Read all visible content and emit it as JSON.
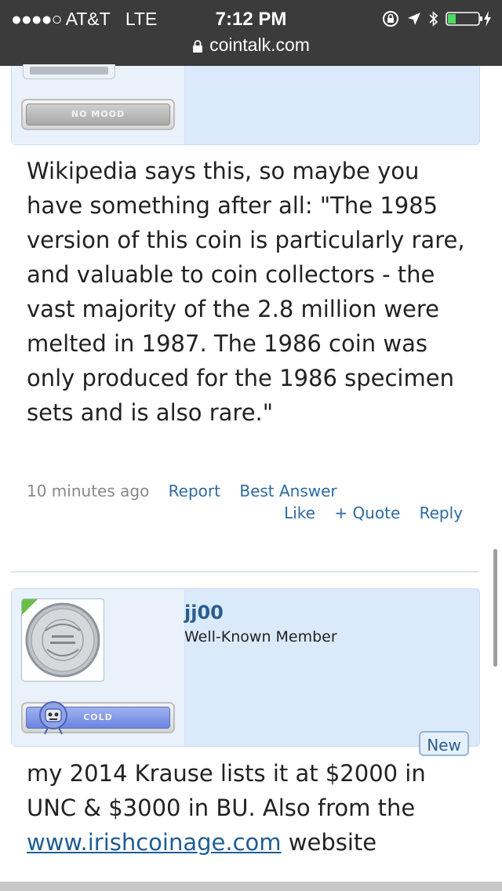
{
  "status_bar": {
    "signal_dots": "●●●●○",
    "carrier": "AT&T",
    "network": "LTE",
    "time": "7:12 PM",
    "url": "cointalk.com",
    "icons": [
      "rotation-lock-icon",
      "location-arrow-icon",
      "bluetooth-icon",
      "battery-charging-icon"
    ]
  },
  "post1": {
    "mood_label": "NO MOOD",
    "body": "Wikipedia says this, so maybe you have something after all: \"The 1985 version of this coin is particularly rare, and valuable to coin collectors - the vast majority of the 2.8 million were melted in 1987. The 1986 coin was only produced for the 1986 specimen sets and is also rare.\"",
    "timestamp": "10 minutes ago",
    "report": "Report",
    "best_answer": "Best Answer",
    "like": "Like",
    "quote": "+ Quote",
    "reply": "Reply"
  },
  "post2": {
    "username": "jj00",
    "user_title": "Well-Known Member",
    "mood_label": "COLD",
    "new_badge": "New",
    "body_start": "my 2014 Krause lists it at $2000 in UNC & $3000 in BU. Also from the ",
    "link_text": "www.irishcoinage.com",
    "body_end": " website"
  },
  "colors": {
    "status_bar_bg": "#3b3b3b",
    "user_panel_bg": "#dbeafa",
    "link": "#2f6aa0",
    "username": "#2a5d8f",
    "online_indicator": "#6cc04a"
  }
}
